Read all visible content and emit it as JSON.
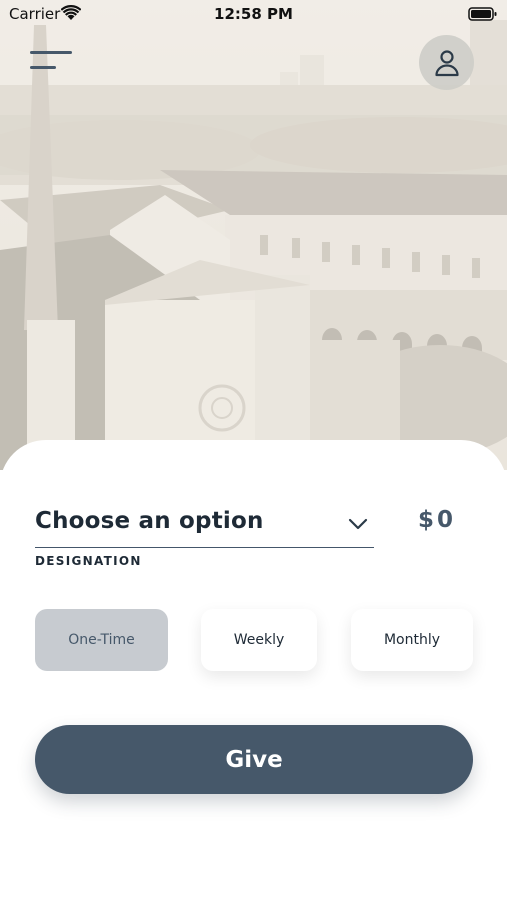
{
  "status_bar": {
    "carrier": "Carrier",
    "time": "12:58 PM",
    "wifi_icon": "wifi-icon",
    "battery_icon": "battery-icon"
  },
  "header": {
    "menu_icon": "hamburger-menu-icon",
    "profile_icon": "person-icon"
  },
  "form": {
    "designation_value": "Choose an option",
    "designation_label": "DESIGNATION",
    "dropdown_icon": "chevron-down-icon",
    "amount": "$0",
    "frequency_options": [
      "One-Time",
      "Weekly",
      "Monthly"
    ],
    "selected_frequency": "One-Time",
    "give_label": "Give"
  },
  "colors": {
    "primary": "#46586a",
    "text_dark": "#1e2a36",
    "selected_option_bg": "#c7cbd0",
    "background": "#ffffff"
  }
}
